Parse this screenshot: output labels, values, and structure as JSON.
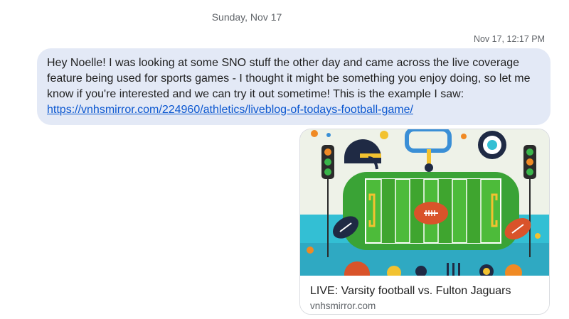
{
  "conversation": {
    "date_header": "Sunday, Nov 17",
    "timestamp": "Nov 17, 12:17 PM"
  },
  "message": {
    "text": "Hey Noelle! I was looking at some SNO stuff the other day and came across the live coverage feature being used for sports games - I thought it might be something you enjoy doing, so let me know if you're interested and we can try it out sometime! This is the example I saw: ",
    "link": "https://vnhsmirror.com/224960/athletics/liveblog-of-todays-football-game/"
  },
  "link_preview": {
    "title": "LIVE: Varsity football vs. Fulton Jaguars",
    "domain": "vnhsmirror.com",
    "image_icon": "football-field-illustration",
    "colors": {
      "field": "#4dbb3a",
      "field_stripe": "#3fa52f",
      "water": "#33bfd4",
      "sky": "#eef2e8",
      "ball": "#d9532a",
      "helmet": "#1f2a44"
    }
  }
}
